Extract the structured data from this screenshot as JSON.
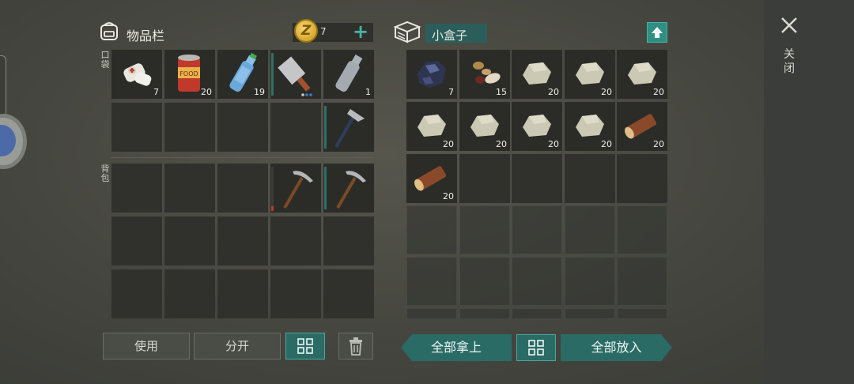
{
  "inventory": {
    "title": "物品栏",
    "coins": "7",
    "coin_glyph": "Z",
    "pocket_label": "口袋",
    "backpack_label": "背包",
    "pocket_items": [
      {
        "icon": "bandage-icon",
        "count": "7"
      },
      {
        "icon": "canned-food-icon",
        "count": "20"
      },
      {
        "icon": "water-bottle-icon",
        "count": "19"
      },
      {
        "icon": "cleaver-icon",
        "count": ""
      },
      {
        "icon": "empty-bottle-icon",
        "count": "1"
      },
      null,
      null,
      null,
      null,
      {
        "icon": "hatchet-icon",
        "count": ""
      }
    ],
    "backpack_items": [
      null,
      null,
      null,
      {
        "icon": "pickaxe-icon",
        "count": ""
      },
      {
        "icon": "pickaxe-icon",
        "count": ""
      },
      null,
      null,
      null,
      null,
      null,
      null,
      null,
      null,
      null,
      null
    ]
  },
  "container": {
    "name": "小盒子",
    "items": [
      {
        "icon": "coal-ore-icon",
        "count": "7"
      },
      {
        "icon": "seeds-icon",
        "count": "15"
      },
      {
        "icon": "stone-icon",
        "count": "20"
      },
      {
        "icon": "stone-icon",
        "count": "20"
      },
      {
        "icon": "stone-icon",
        "count": "20"
      },
      {
        "icon": "stone-icon",
        "count": "20"
      },
      {
        "icon": "stone-icon",
        "count": "20"
      },
      {
        "icon": "stone-icon",
        "count": "20"
      },
      {
        "icon": "stone-icon",
        "count": "20"
      },
      {
        "icon": "wood-log-icon",
        "count": "20"
      },
      {
        "icon": "wood-log-icon",
        "count": "20"
      }
    ]
  },
  "buttons": {
    "use": "使用",
    "split": "分开",
    "take_all": "全部拿上",
    "put_all": "全部放入"
  },
  "close_label": "关闭",
  "colors": {
    "accent_teal": "#2a6b66",
    "highlight_teal": "#48b3a4",
    "coin_gold": "#e2b53a"
  }
}
